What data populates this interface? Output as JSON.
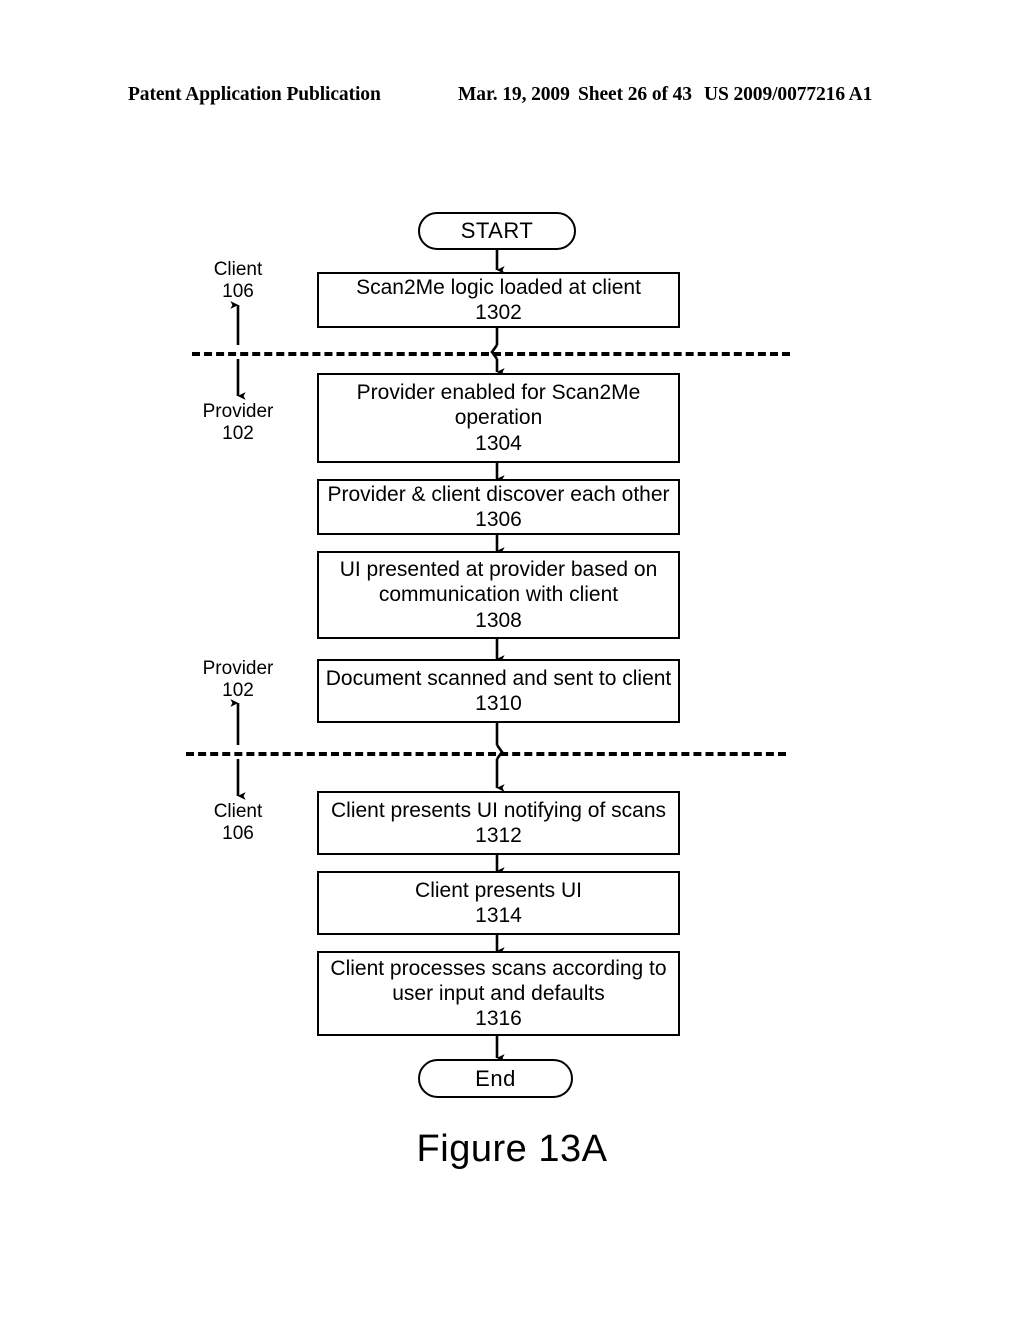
{
  "header": {
    "publication": "Patent Application Publication",
    "date": "Mar. 19, 2009",
    "sheet": "Sheet 26 of 43",
    "number": "US 2009/0077216 A1"
  },
  "figure": {
    "caption": "Figure 13A"
  },
  "flowchart": {
    "start_label": "START",
    "end_label": "End",
    "steps": [
      {
        "text": "Scan2Me logic loaded at client",
        "ref": "1302"
      },
      {
        "text": "Provider enabled for Scan2Me operation",
        "ref": "1304"
      },
      {
        "text": "Provider & client discover each other",
        "ref": "1306"
      },
      {
        "text": "UI presented at provider based on communication with client",
        "ref": "1308"
      },
      {
        "text": "Document scanned and sent to client",
        "ref": "1310"
      },
      {
        "text": "Client presents UI notifying of scans",
        "ref": "1312"
      },
      {
        "text": "Client presents UI",
        "ref": "1314"
      },
      {
        "text": "Client processes scans according to user input and defaults",
        "ref": "1316"
      }
    ],
    "step_lines": {
      "s1302": [
        "Scan2Me logic loaded at client"
      ],
      "s1304": [
        "Provider enabled for Scan2Me",
        "operation"
      ],
      "s1306": [
        "Provider & client discover each other"
      ],
      "s1308": [
        "UI presented at provider based on",
        "communication with client"
      ],
      "s1310": [
        "Document scanned and sent to client"
      ],
      "s1312": [
        "Client presents UI notifying of scans"
      ],
      "s1314": [
        "Client presents UI"
      ],
      "s1316": [
        "Client processes scans according to",
        "user input and defaults"
      ]
    },
    "lanes": [
      {
        "name": "Client",
        "ref": "106",
        "position": "above-divider-1"
      },
      {
        "name": "Provider",
        "ref": "102",
        "position": "below-divider-1"
      },
      {
        "name": "Provider",
        "ref": "102",
        "position": "above-divider-2"
      },
      {
        "name": "Client",
        "ref": "106",
        "position": "below-divider-2"
      }
    ],
    "divider_count": 2,
    "line_color": "#000000",
    "background_color": "#ffffff"
  }
}
